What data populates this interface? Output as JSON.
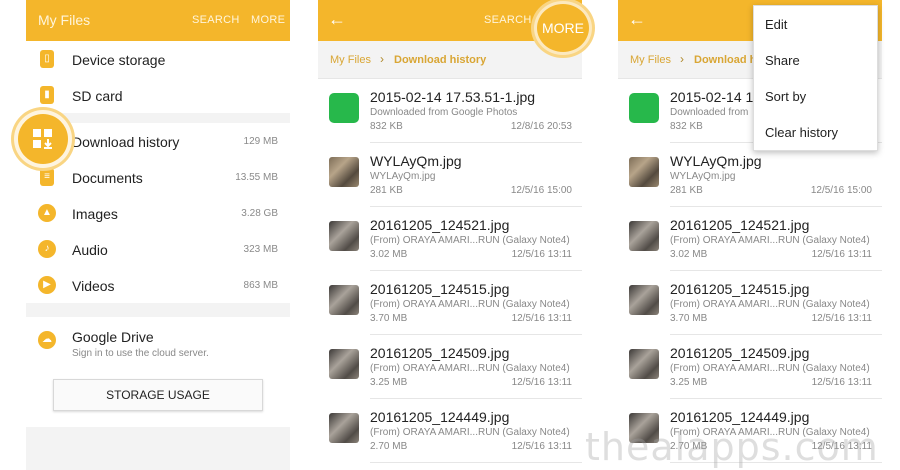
{
  "panel1": {
    "title": "My Files",
    "search_label": "SEARCH",
    "more_label": "MORE",
    "items": [
      {
        "label": "Device storage",
        "size": ""
      },
      {
        "label": "SD card",
        "size": ""
      },
      {
        "label": "Download history",
        "size": "129 MB"
      },
      {
        "label": "Documents",
        "size": "13.55 MB"
      },
      {
        "label": "Images",
        "size": "3.28 GB"
      },
      {
        "label": "Audio",
        "size": "323 MB"
      },
      {
        "label": "Videos",
        "size": "863 MB"
      }
    ],
    "drive": {
      "label": "Google Drive",
      "sub": "Sign in to use the cloud server."
    },
    "storage_button": "STORAGE USAGE"
  },
  "panel2": {
    "search_label": "SEARCH",
    "more_label": "MORE",
    "breadcrumb": {
      "root": "My Files",
      "current": "Download history"
    }
  },
  "panel3": {
    "breadcrumb": {
      "root": "My Files",
      "current": "Download hi"
    },
    "menu": [
      "Edit",
      "Share",
      "Sort by",
      "Clear history"
    ]
  },
  "files": [
    {
      "name": "2015-02-14 17.53.51-1.jpg",
      "source": "Downloaded from Google Photos",
      "size": "832 KB",
      "date": "12/8/16 20:53",
      "source_short": "Downloaded from",
      "thumb": "green"
    },
    {
      "name": "WYLAyQm.jpg",
      "source": "WYLAyQm.jpg",
      "size": "281 KB",
      "date": "12/5/16 15:00",
      "source_short": "WYLAyQm.jpg",
      "thumb": "photo"
    },
    {
      "name": "20161205_124521.jpg",
      "source": "(From) ORAYA AMARI...RUN (Galaxy Note4)",
      "size": "3.02 MB",
      "date": "12/5/16 13:11",
      "source_short": "(From) ORAYA AMARI...RUN (Galaxy Note4)",
      "thumb": "photo2"
    },
    {
      "name": "20161205_124515.jpg",
      "source": "(From) ORAYA AMARI...RUN (Galaxy Note4)",
      "size": "3.70 MB",
      "date": "12/5/16 13:11",
      "source_short": "(From) ORAYA AMARI...RUN (Galaxy Note4)",
      "thumb": "photo2"
    },
    {
      "name": "20161205_124509.jpg",
      "source": "(From) ORAYA AMARI...RUN (Galaxy Note4)",
      "size": "3.25 MB",
      "date": "12/5/16 13:11",
      "source_short": "(From) ORAYA AMARI...RUN (Galaxy Note4)",
      "thumb": "photo2"
    },
    {
      "name": "20161205_124449.jpg",
      "source": "(From) ORAYA AMARI...RUN (Galaxy Note4)",
      "size": "2.70 MB",
      "date": "12/5/16 13:11",
      "source_short": "(From) ORAYA AMARI...RUN (Galaxy Note4)",
      "thumb": "photo2"
    }
  ],
  "watermark": "thealapps.com",
  "colors": {
    "accent": "#f4b62b",
    "accent_light": "#f9d583",
    "green": "#27b84b"
  }
}
